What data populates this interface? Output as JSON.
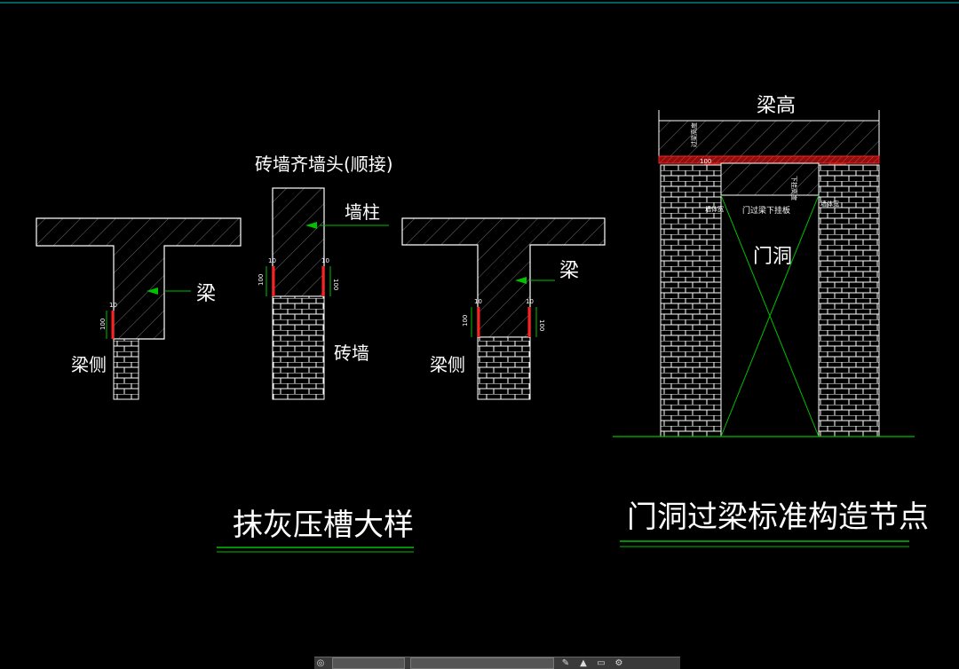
{
  "drawing": {
    "title_left": "抹灰压槽大样",
    "title_right": "门洞过梁标准构造节点",
    "detail1": {
      "beam": "梁",
      "beam_side": "梁侧",
      "dim_top": "10",
      "dim_side": "100"
    },
    "detail2": {
      "heading": "砖墙齐墙头(顺接)",
      "column": "墙柱",
      "brick_wall": "砖墙",
      "dim_top_l": "10",
      "dim_top_r": "10",
      "dim_side_l": "100",
      "dim_side_r": "100"
    },
    "detail3": {
      "beam": "梁",
      "beam_side": "梁侧",
      "dim_top_l": "10",
      "dim_top_r": "10",
      "dim_side_l": "100",
      "dim_side_r": "100"
    },
    "detail4": {
      "beam_height": "梁高",
      "opening": "门洞",
      "lintel_note": "门过梁下挂板",
      "dim_small": "100",
      "note_left": "过梁高度",
      "note_mid": "下挂高度",
      "note_l2": "墙体宽",
      "note_r2": "墙体宽"
    }
  },
  "colors": {
    "line": "#ffffff",
    "hatch": "#8a8a8a",
    "leader": "#00c000",
    "red": "#ff2020",
    "bg": "#000000",
    "border": "#00bcbc"
  }
}
